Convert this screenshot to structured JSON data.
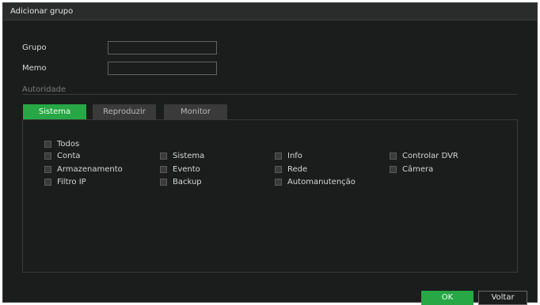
{
  "dialog": {
    "title": "Adicionar grupo"
  },
  "form": {
    "group_label": "Grupo",
    "group_value": "",
    "memo_label": "Memo",
    "memo_value": ""
  },
  "authority": {
    "label": "Autoridade",
    "tabs": [
      {
        "label": "Sistema",
        "active": true
      },
      {
        "label": "Reproduzir",
        "active": false
      },
      {
        "label": "Monitor",
        "active": false
      }
    ],
    "all": {
      "label": "Todos",
      "checked": false
    },
    "permissions": [
      {
        "label": "Conta",
        "checked": false
      },
      {
        "label": "Sistema",
        "checked": false
      },
      {
        "label": "Info",
        "checked": false
      },
      {
        "label": "Controlar DVR",
        "checked": false
      },
      {
        "label": "Armazenamento",
        "checked": false
      },
      {
        "label": "Evento",
        "checked": false
      },
      {
        "label": "Rede",
        "checked": false
      },
      {
        "label": "Câmera",
        "checked": false
      },
      {
        "label": "Filtro IP",
        "checked": false
      },
      {
        "label": "Backup",
        "checked": false
      },
      {
        "label": "Automanutenção",
        "checked": false
      }
    ]
  },
  "buttons": {
    "ok": "OK",
    "back": "Voltar"
  },
  "colors": {
    "accent": "#27a745",
    "background": "#1b1c1c",
    "titlebar": "#2a2b2b"
  }
}
